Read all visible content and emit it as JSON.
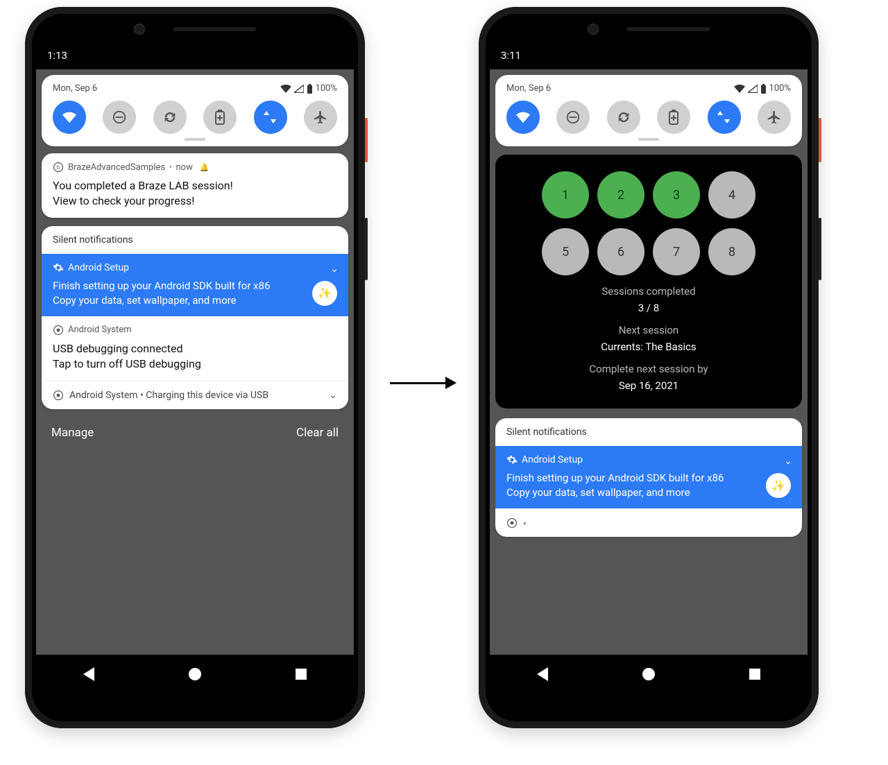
{
  "left": {
    "clock": "1:13",
    "date": "Mon, Sep 6",
    "battery": "100%",
    "notif": {
      "app": "BrazeAdvancedSamples",
      "time": "now",
      "title": "You completed a Braze LAB session!",
      "subtitle": "View to check your progress!"
    },
    "silent_label": "Silent notifications",
    "setup": {
      "header": "Android Setup",
      "line1": "Finish setting up your Android SDK built for x86",
      "line2": "Copy your data, set wallpaper, and more"
    },
    "system": {
      "header": "Android System",
      "line1": "USB debugging connected",
      "line2": "Tap to turn off USB debugging"
    },
    "charging_row": "Android System  •  Charging this device via USB",
    "manage": "Manage",
    "clear_all": "Clear all"
  },
  "right": {
    "clock": "3:11",
    "date": "Mon, Sep 6",
    "battery": "100%",
    "dots_row1": [
      "1",
      "2",
      "3",
      "4"
    ],
    "dots_row2": [
      "5",
      "6",
      "7",
      "8"
    ],
    "completed_done": 3,
    "sessions_label": "Sessions completed",
    "sessions_count": "3 / 8",
    "next_label": "Next session",
    "next_value": "Currents: The Basics",
    "due_label": "Complete next session by",
    "due_value": "Sep 16, 2021",
    "silent_label": "Silent notifications",
    "setup": {
      "header": "Android Setup",
      "line1": "Finish setting up your Android SDK built for x86",
      "line2": "Copy your data, set wallpaper, and more"
    }
  },
  "qs_tiles": [
    {
      "name": "wifi",
      "on": true
    },
    {
      "name": "dnd",
      "on": false
    },
    {
      "name": "rotate",
      "on": false
    },
    {
      "name": "battery-saver",
      "on": false
    },
    {
      "name": "data",
      "on": true
    },
    {
      "name": "airplane",
      "on": false
    }
  ]
}
